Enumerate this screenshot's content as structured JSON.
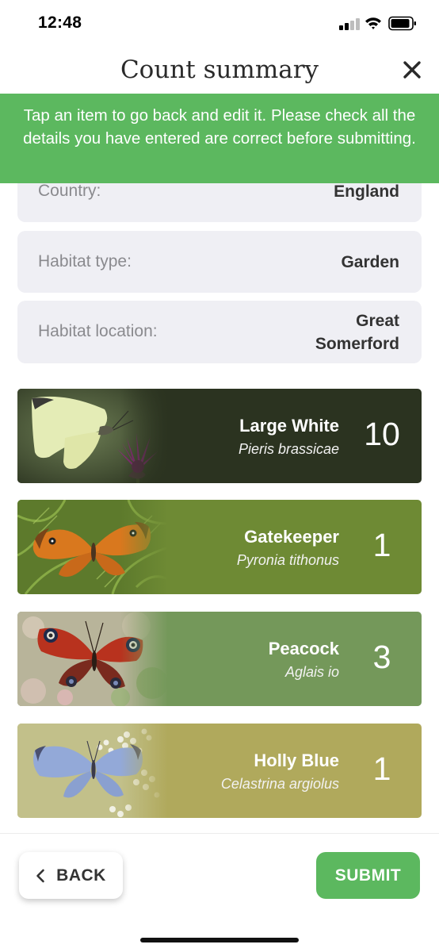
{
  "status_bar": {
    "time": "12:48"
  },
  "header": {
    "title": "Count summary",
    "close_icon": "close-icon"
  },
  "banner": {
    "text": "Tap an item to go back and edit it. Please check all the details you have entered are correct before submitting."
  },
  "details": [
    {
      "label": "Country:",
      "value": "England"
    },
    {
      "label": "Habitat type:",
      "value": "Garden"
    },
    {
      "label": "Habitat location:",
      "value_line1": "Great",
      "value_line2": "Somerford"
    }
  ],
  "species": [
    {
      "name": "Large White",
      "latin": "Pieris brassicae",
      "count": "10",
      "color": "#2b3320"
    },
    {
      "name": "Gatekeeper",
      "latin": "Pyronia tithonus",
      "count": "1",
      "color": "#6e8a34"
    },
    {
      "name": "Peacock",
      "latin": "Aglais io",
      "count": "3",
      "color": "#74985a"
    },
    {
      "name": "Holly Blue",
      "latin": "Celastrina argiolus",
      "count": "1",
      "color": "#b0a95c"
    }
  ],
  "footer": {
    "back_label": "BACK",
    "submit_label": "SUBMIT"
  },
  "colors": {
    "accent": "#5cb85f",
    "info_bg": "#efeff4"
  }
}
